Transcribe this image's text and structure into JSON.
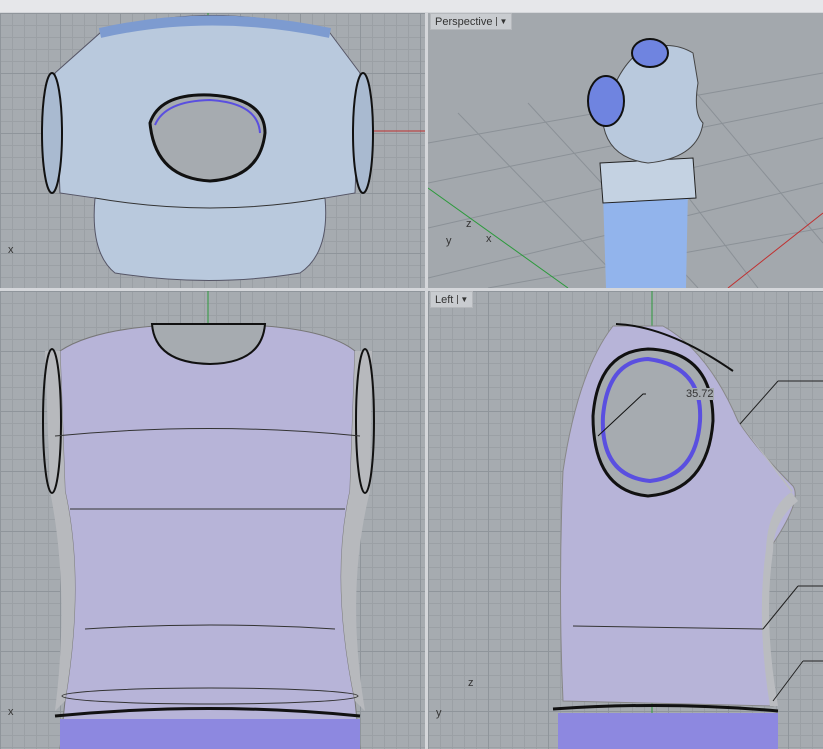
{
  "viewports": {
    "top": {
      "axis_x": "x"
    },
    "perspective": {
      "label": "Perspective",
      "dropdown_icon": "chevron-down-icon",
      "axis_x": "x",
      "axis_y": "y",
      "axis_z": "z"
    },
    "front": {
      "axis_x": "x"
    },
    "left": {
      "label": "Left",
      "dropdown_icon": "chevron-down-icon",
      "axis_y": "y",
      "axis_z": "z",
      "dimension": "35.72"
    }
  },
  "colors": {
    "surface": "#b9c9dd",
    "torso": "#b7b4d8",
    "edge_highlight": "#5a4fe0",
    "x_axis": "#c03030",
    "z_axis": "#2c9a3c"
  }
}
